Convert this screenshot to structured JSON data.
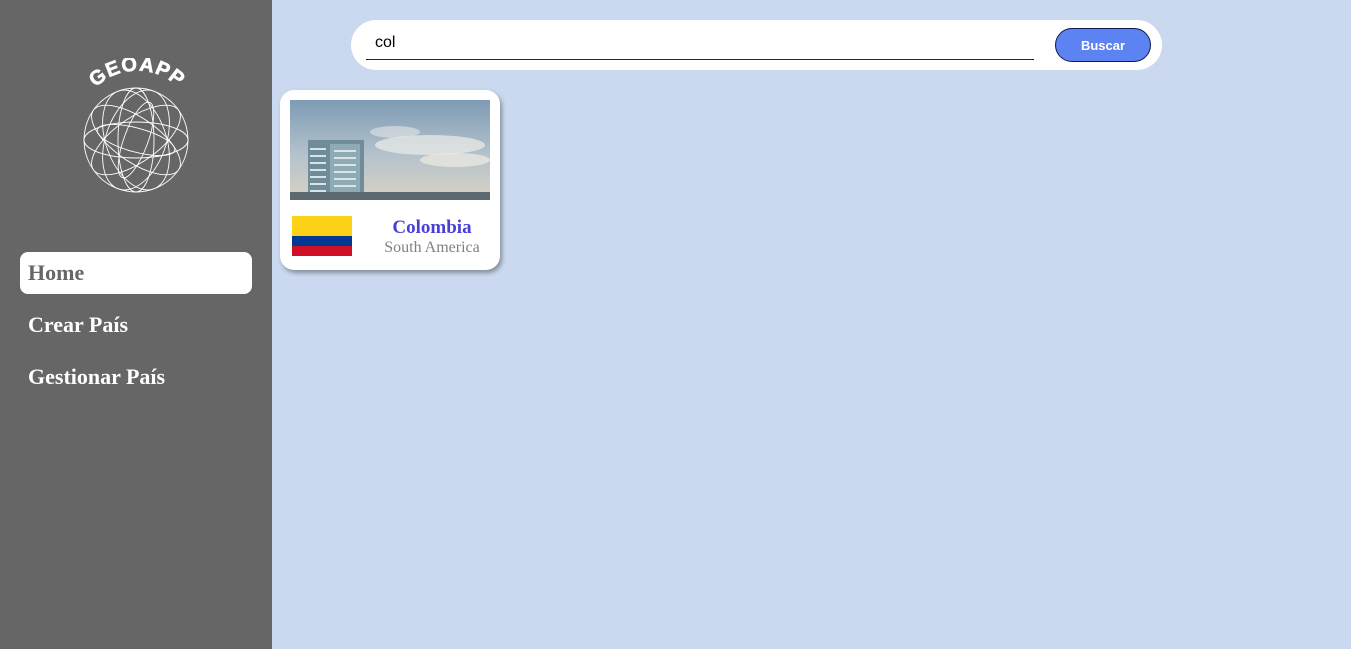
{
  "sidebar": {
    "logo_text": "GEOAPP",
    "nav": [
      {
        "label": "Home",
        "active": true
      },
      {
        "label": "Crear País",
        "active": false
      },
      {
        "label": "Gestionar País",
        "active": false
      }
    ]
  },
  "search": {
    "value": "col",
    "button_label": "Buscar"
  },
  "results": [
    {
      "country": "Colombia",
      "continent": "South America",
      "flag_colors": [
        "#fcd116",
        "#003893",
        "#ce1126"
      ]
    }
  ],
  "colors": {
    "sidebar_bg": "#666666",
    "main_bg": "#cad9ef",
    "accent_button": "#5d82f2",
    "country_name": "#4a3fd6"
  }
}
